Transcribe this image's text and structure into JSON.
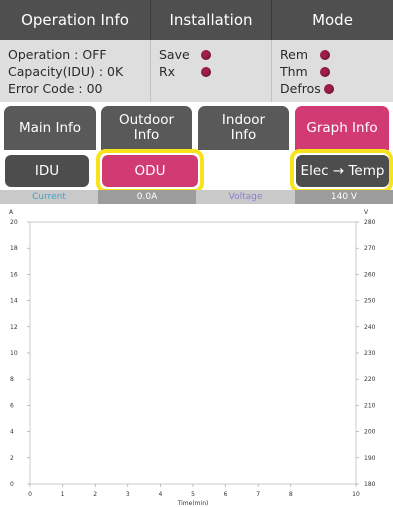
{
  "header": {
    "operation_info": "Operation Info",
    "installation": "Installation",
    "mode": "Mode"
  },
  "operation": {
    "line1": "Operation : OFF",
    "line2": "Capacity(IDU) : 0K",
    "line3": "Error Code : 00"
  },
  "installation": {
    "save": "Save",
    "rx": "Rx"
  },
  "mode": {
    "rem": "Rem",
    "thm": "Thm",
    "defros": "Defros"
  },
  "tabs": {
    "main": "Main Info",
    "outdoor_1": "Outdoor",
    "outdoor_2": "Info",
    "indoor_1": "Indoor",
    "indoor_2": "Info",
    "graph": "Graph Info"
  },
  "buttons": {
    "idu": "IDU",
    "odu": "ODU",
    "elec_temp": "Elec → Temp"
  },
  "legend": {
    "current_label": "Current",
    "current_value": "0.0A",
    "voltage_label": "Voltage",
    "voltage_value": "140 V"
  },
  "colors": {
    "dark_panel": "#4f4f4f",
    "light_panel": "#dedede",
    "accent_pink": "#d23a73",
    "indicator": "#9d1e4a",
    "highlight": "#f7e21c"
  },
  "chart_data": {
    "type": "line",
    "xlabel": "Time(min)",
    "ylabel_left": "A",
    "ylabel_right": "V",
    "x_ticks": [
      0,
      1,
      2,
      3,
      4,
      5,
      6,
      7,
      8,
      10
    ],
    "y_left_ticks": [
      0,
      2,
      4,
      6,
      8,
      10,
      12,
      14,
      16,
      18,
      20
    ],
    "y_right_ticks": [
      180,
      190,
      200,
      210,
      220,
      230,
      240,
      250,
      260,
      270,
      280
    ],
    "xlim": [
      0,
      10
    ],
    "ylim_left": [
      0,
      20
    ],
    "ylim_right": [
      180,
      280
    ],
    "grid": false,
    "series": []
  }
}
